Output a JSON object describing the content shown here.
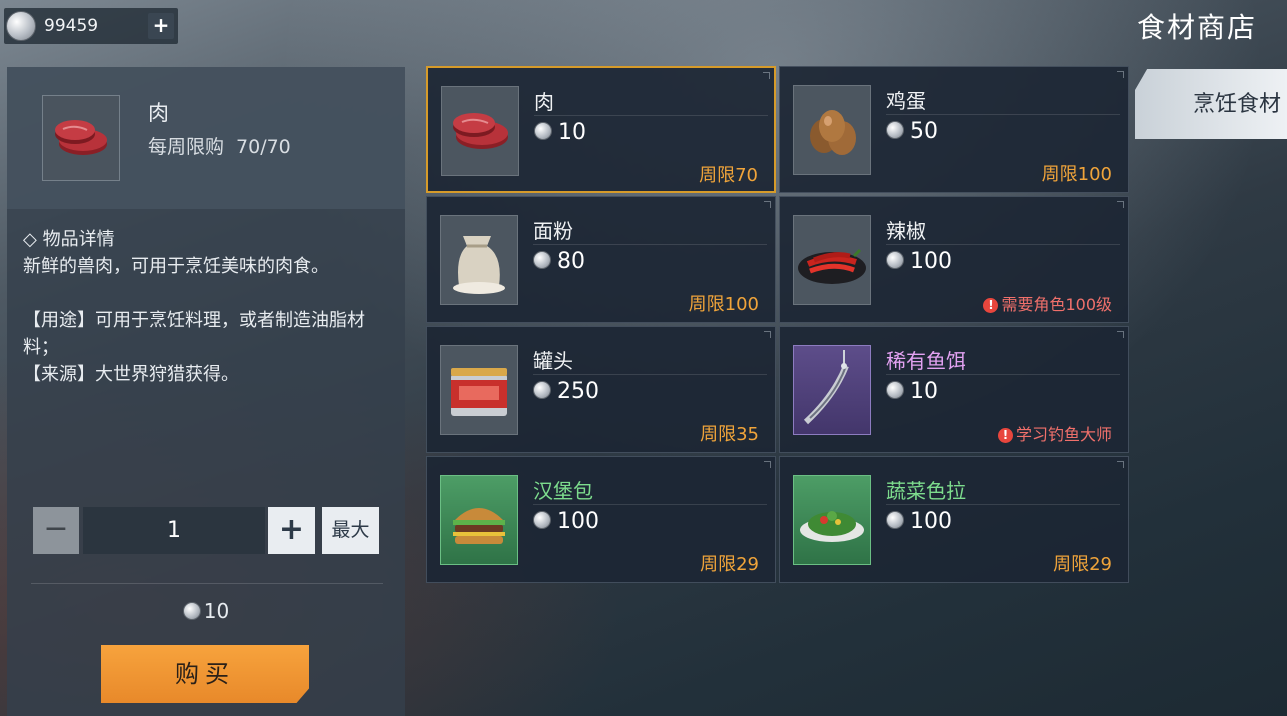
{
  "top_bar": {
    "coin_amount": "99459",
    "add_label": "+",
    "shop_title": "食材商店"
  },
  "detail": {
    "name": "肉",
    "limit_label": "每周限购",
    "limit_value": "70/70",
    "section_title": "物品详情",
    "desc_lines": [
      "新鲜的兽肉，可用于烹饪美味的肉食。",
      "",
      "【用途】可用于烹饪料理，或者制造油脂材料；",
      "【来源】大世界狩猎获得。"
    ]
  },
  "quantity": {
    "minus": "−",
    "value": "1",
    "plus": "+",
    "max": "最大"
  },
  "total_price": "10",
  "buy_label": "购买",
  "category_tab": "烹饪食材",
  "items": [
    {
      "name": "肉",
      "price": "10",
      "note": "周限70",
      "note_type": "limit",
      "icon": "meat-icon",
      "thumb": "default",
      "name_style": "normal",
      "selected": true
    },
    {
      "name": "鸡蛋",
      "price": "50",
      "note": "周限100",
      "note_type": "limit",
      "icon": "egg-icon",
      "thumb": "default",
      "name_style": "normal",
      "selected": false
    },
    {
      "name": "面粉",
      "price": "80",
      "note": "周限100",
      "note_type": "limit",
      "icon": "flour-sack-icon",
      "thumb": "default",
      "name_style": "normal",
      "selected": false
    },
    {
      "name": "辣椒",
      "price": "100",
      "note": "需要角色100级",
      "note_type": "warn",
      "icon": "chili-pepper-icon",
      "thumb": "default",
      "name_style": "normal",
      "selected": false
    },
    {
      "name": "罐头",
      "price": "250",
      "note": "周限35",
      "note_type": "limit",
      "icon": "canned-food-icon",
      "thumb": "default",
      "name_style": "normal",
      "selected": false
    },
    {
      "name": "稀有鱼饵",
      "price": "10",
      "note": "学习钓鱼大师",
      "note_type": "warn",
      "icon": "fishing-bait-icon",
      "thumb": "purple",
      "name_style": "rare",
      "selected": false
    },
    {
      "name": "汉堡包",
      "price": "100",
      "note": "周限29",
      "note_type": "limit",
      "icon": "burger-icon",
      "thumb": "green",
      "name_style": "green",
      "selected": false
    },
    {
      "name": "蔬菜色拉",
      "price": "100",
      "note": "周限29",
      "note_type": "limit",
      "icon": "salad-icon",
      "thumb": "green",
      "name_style": "green",
      "selected": false
    }
  ]
}
